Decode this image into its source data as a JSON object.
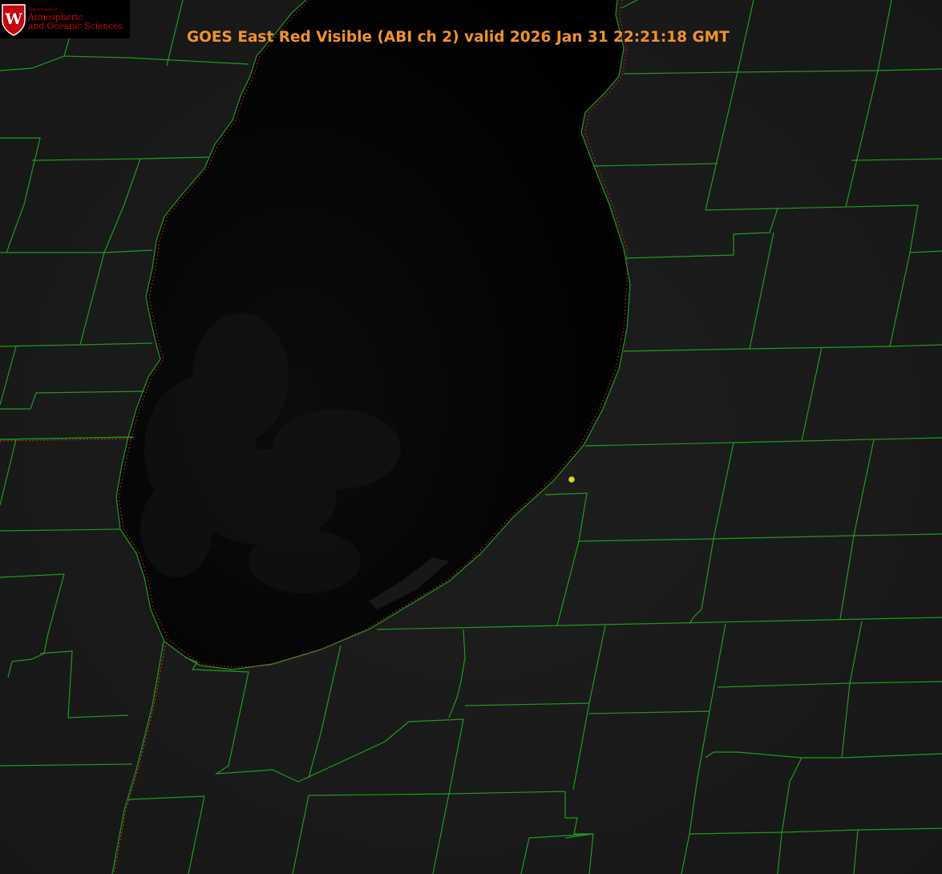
{
  "title": "GOES East Red Visible (ABI ch 2) valid 2026 Jan 31 22:21:18 GMT",
  "logo": {
    "crest_letter": "W",
    "department": "Department of",
    "line1": "Atmospheric",
    "line2": "and Oceanic Sciences"
  },
  "colors": {
    "title": "#f0922a",
    "county_lines": "#1f9a1f",
    "state_line": "#e0321e",
    "shoreline": "#d81e1e",
    "marker": "#d8d820",
    "land": "#1b1b1b",
    "lake": "#020202",
    "logo_red": "#c5050c"
  },
  "map": {
    "product": "GOES East Red Visible (ABI ch 2)",
    "region": "Lake Michigan",
    "overlays": [
      "county-boundaries",
      "state-boundaries",
      "shoreline",
      "station-marker"
    ]
  }
}
